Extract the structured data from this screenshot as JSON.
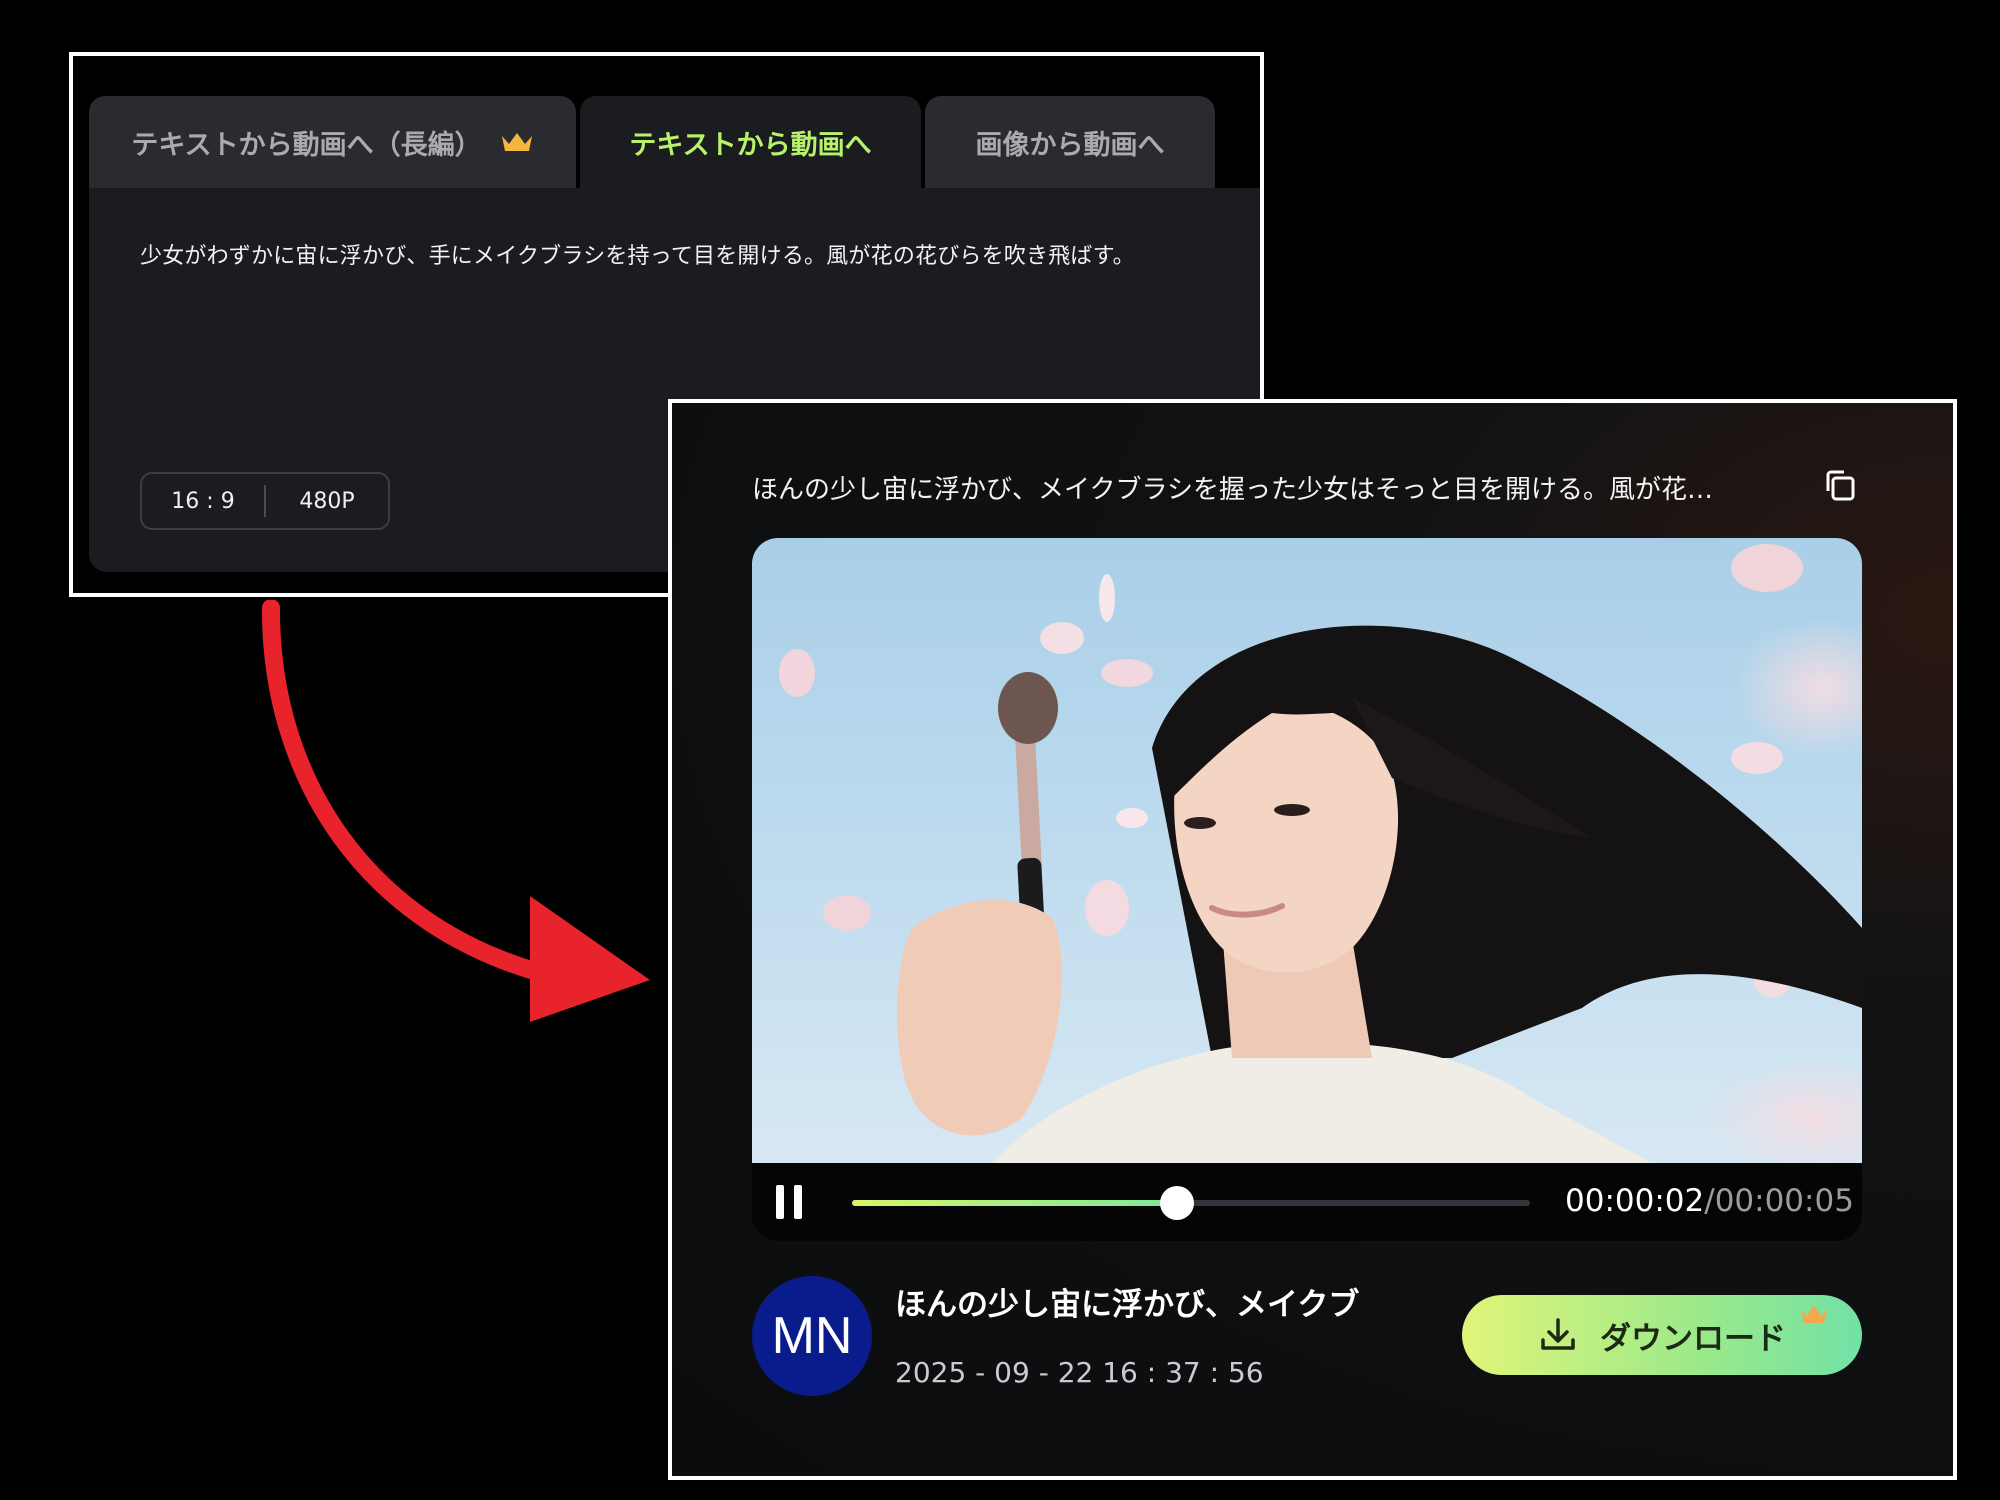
{
  "input_panel": {
    "tabs": [
      {
        "label": "テキストから動画へ（長編）",
        "icon": "crown-icon",
        "selected": false
      },
      {
        "label": "テキストから動画へ",
        "selected": true
      },
      {
        "label": "画像から動画へ",
        "selected": false
      }
    ],
    "prompt": "少女がわずかに宙に浮かび、手にメイクブラシを持って目を開ける。風が花の花びらを吹き飛ばす。",
    "aspect_ratio": "16 : 9",
    "resolution": "480P"
  },
  "result_panel": {
    "title": "ほんの少し宙に浮かび、メイクブラシを握った少女はそっと目を開ける。風が花…",
    "copy_icon": "copy-icon",
    "player": {
      "current_time": "00:00:02",
      "separator": "/",
      "total_time": "00:00:05",
      "progress": 0.48,
      "state": "playing"
    },
    "avatar_initials": "MN",
    "video_name": "ほんの少し宙に浮かび、メイクブ",
    "created_at": "2025 - 09 - 22 16 : 37 : 56",
    "download_label": "ダウンロード"
  },
  "colors": {
    "accent_green": "#b7f26a",
    "arrow_red": "#e8232b",
    "avatar_blue": "#0a1c8c"
  }
}
